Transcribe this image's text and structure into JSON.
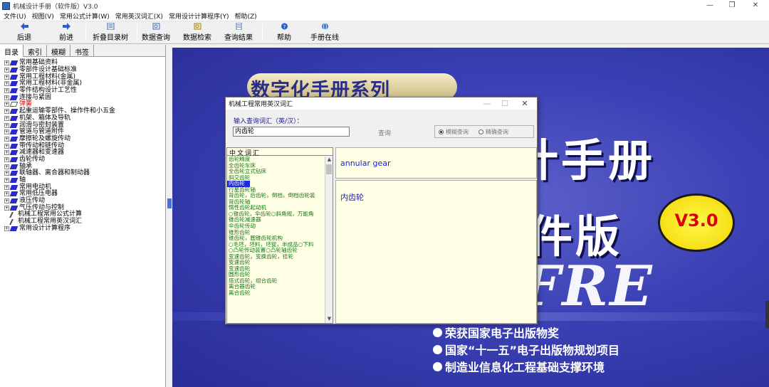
{
  "window": {
    "title": "机械设计手册（软件版）V3.0",
    "controls": [
      "—",
      "❐",
      "✕"
    ]
  },
  "menu": [
    "文件(U)",
    "视图(V)",
    "常用公式计算(W)",
    "常用英汉词汇(X)",
    "常用设计计算程序(Y)",
    "帮助(Z)"
  ],
  "toolbar": {
    "back": "后退",
    "forward": "前进",
    "collapse_tree": "折叠目录树",
    "data_query": "数据查询",
    "data_search": "数据检索",
    "query_results": "查询结果",
    "help": "帮助",
    "handbook_online": "手册在线"
  },
  "left_tabs": [
    "目录",
    "索引",
    "模糊",
    "书签"
  ],
  "tree": [
    {
      "label": "常用基础资料",
      "type": "book"
    },
    {
      "label": "零部件设计基础标准",
      "type": "book"
    },
    {
      "label": "常用工程材料(金属)",
      "type": "book"
    },
    {
      "label": "常用工程材料(非金属)",
      "type": "book"
    },
    {
      "label": "零件结构设计工艺性",
      "type": "book"
    },
    {
      "label": "连接与紧固",
      "type": "book"
    },
    {
      "label": "弹簧",
      "type": "open",
      "color": "red"
    },
    {
      "label": "起重运输零部件、操作件和小五金",
      "type": "book"
    },
    {
      "label": "机架、箱体及导轨",
      "type": "book"
    },
    {
      "label": "润滑与密封装置",
      "type": "book"
    },
    {
      "label": "管道与管道附件",
      "type": "book"
    },
    {
      "label": "摩擦轮及螺旋传动",
      "type": "book"
    },
    {
      "label": "带传动和链传动",
      "type": "book"
    },
    {
      "label": "减速器和变速器",
      "type": "book"
    },
    {
      "label": "齿轮传动",
      "type": "book"
    },
    {
      "label": "轴承",
      "type": "book"
    },
    {
      "label": "联轴器、离合器和制动器",
      "type": "book"
    },
    {
      "label": "轴",
      "type": "book"
    },
    {
      "label": "常用电动机",
      "type": "book"
    },
    {
      "label": "常用低压电器",
      "type": "book"
    },
    {
      "label": "液压传动",
      "type": "book"
    },
    {
      "label": "气压传动与控制",
      "type": "book"
    },
    {
      "label": "机械工程常用公式计算",
      "type": "doc"
    },
    {
      "label": "机械工程常用英汉词汇",
      "type": "doc"
    },
    {
      "label": "常用设计计算程序",
      "type": "book"
    }
  ],
  "splash": {
    "series": "数字化手册系列",
    "big_line1": "计手册",
    "big_line2": "件版",
    "version_badge": "V3.0",
    "fre": "FRE",
    "bullets": [
      "荣获国家电子出版物奖",
      "国家“十一五”电子出版物规划项目",
      "制造业信息化工程基础支撑环境"
    ]
  },
  "dialog": {
    "title": "机械工程常用英汉词汇",
    "window_controls": [
      "—",
      "☐",
      "✕"
    ],
    "input_label": "输入查询词汇（英/汉）：",
    "input_value": "内齿轮",
    "query_button": "查询",
    "mode_fuzzy": "模糊查询",
    "mode_exact": "精确查询",
    "list_header": "中文词汇",
    "list_items": [
      "齿轮精度",
      "全齿轮车床",
      "全齿轮立式钻床",
      "斜交齿轮",
      "内齿轮",
      "行星齿轮轴",
      "背齿轮，后齿轮，倒档，倒档齿轮装",
      "背齿轮轴",
      "惰性齿轮起动机",
      "○锥齿轮，伞齿轮○斜角规，万能角",
      "锥齿轮减速器",
      "伞齿轮传动",
      "锥形齿轮",
      "锥齿轮，圆锥齿轮机构",
      "○毛坯，坯料，坯锭，半成品○下料",
      "○凸轮传动装置○凸轮轴齿轮",
      "变速齿轮，变换齿轮，挂轮",
      "变速齿轮",
      "变速齿轮",
      "圆形齿轮",
      "塔式齿轮，组合齿轮",
      "离合器齿轮",
      "离合齿轮"
    ],
    "selected_index": 4,
    "english_result": "annular gear",
    "chinese_result": "内齿轮"
  }
}
